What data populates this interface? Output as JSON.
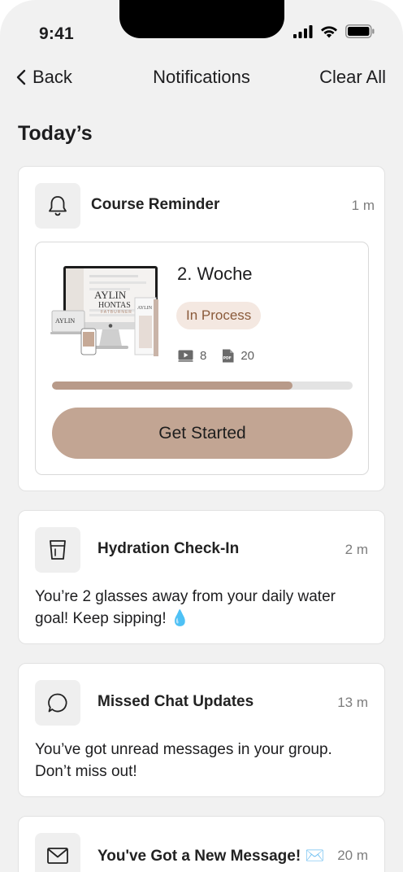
{
  "status_bar": {
    "time": "9:41"
  },
  "nav": {
    "back_label": "Back",
    "title": "Notifications",
    "clear_all_label": "Clear All"
  },
  "section_title": "Today’s",
  "notifications": [
    {
      "title": "Course Reminder",
      "time": "1 m",
      "icon": "bell-icon",
      "course": {
        "week": "2. Woche",
        "status": "In Process",
        "videos": "8",
        "pdfs": "20",
        "progress": 0.8,
        "cta_label": "Get Started",
        "thumbnail_brand": "AYLIN HONTAS",
        "thumbnail_sub": "FATBURNER"
      }
    },
    {
      "title": "Hydration Check-In",
      "time": "2 m",
      "icon": "glass-icon",
      "body": "You’re 2 glasses away from your daily water goal! Keep sipping! 💧"
    },
    {
      "title": "Missed Chat Updates",
      "time": "13 m",
      "icon": "chat-bubble-icon",
      "body": "You’ve got unread messages in your group. Don’t miss out!"
    },
    {
      "title": "You've Got a New Message! ✉️",
      "time": "20 m",
      "icon": "envelope-icon"
    }
  ],
  "colors": {
    "accent": "#c2a593",
    "badge_bg": "#f4e8e1",
    "badge_text": "#8a5a3a",
    "page_bg": "#f1f1f1"
  }
}
